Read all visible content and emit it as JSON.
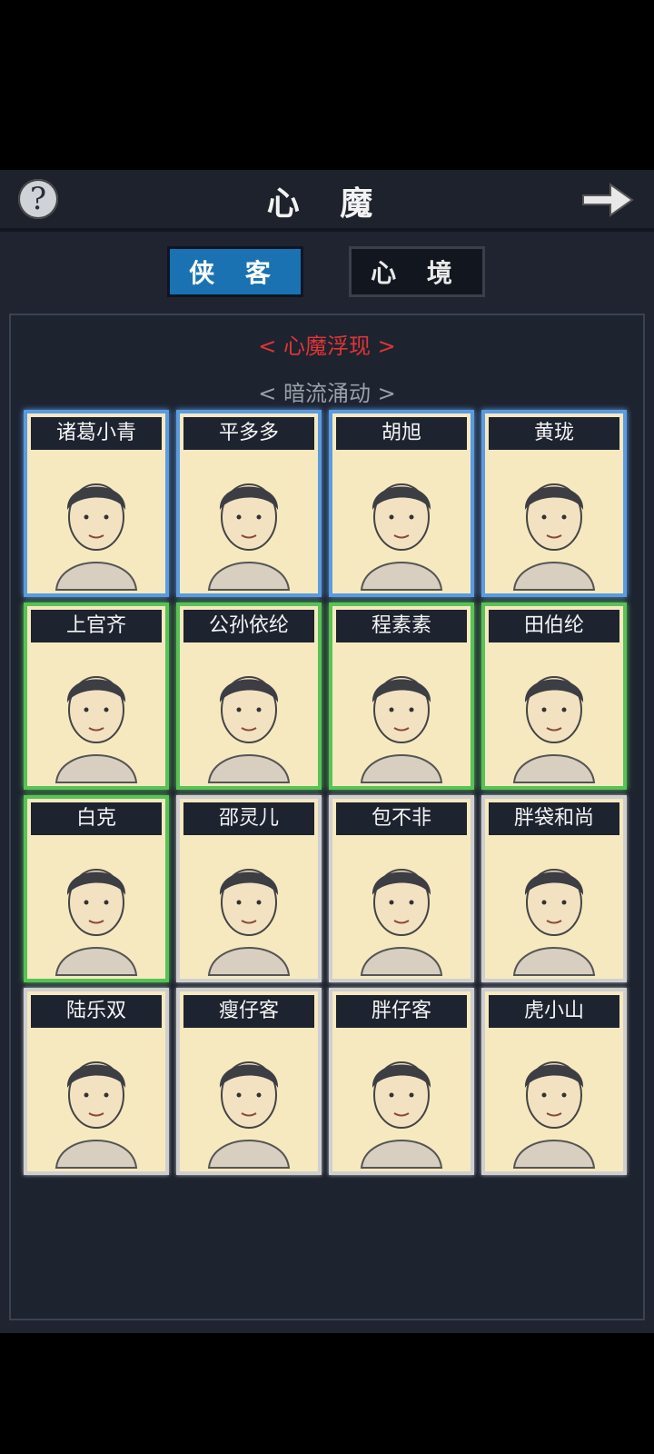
{
  "header": {
    "title": "心 魔",
    "help_symbol": "?",
    "next_icon": "arrow-right-icon"
  },
  "tabs": [
    {
      "label": "侠 客",
      "active": true
    },
    {
      "label": "心 境",
      "active": false
    }
  ],
  "sections": {
    "main": "< 心魔浮现 >",
    "sub": "< 暗流涌动 >"
  },
  "colors": {
    "blue": "#5b9be0",
    "green": "#58c257",
    "white": "#cfcfcf",
    "accent_red": "#e03535",
    "tab_active": "#1a72b3"
  },
  "characters": [
    {
      "name": "诸葛小青",
      "tier": "blue"
    },
    {
      "name": "平多多",
      "tier": "blue"
    },
    {
      "name": "胡旭",
      "tier": "blue"
    },
    {
      "name": "黄珑",
      "tier": "blue"
    },
    {
      "name": "上官齐",
      "tier": "green"
    },
    {
      "name": "公孙依纶",
      "tier": "green"
    },
    {
      "name": "程素素",
      "tier": "green"
    },
    {
      "name": "田伯纶",
      "tier": "green"
    },
    {
      "name": "白克",
      "tier": "green"
    },
    {
      "name": "邵灵儿",
      "tier": "white"
    },
    {
      "name": "包不非",
      "tier": "white"
    },
    {
      "name": "胖袋和尚",
      "tier": "white"
    },
    {
      "name": "陆乐双",
      "tier": "white"
    },
    {
      "name": "瘦仔客",
      "tier": "white"
    },
    {
      "name": "胖仔客",
      "tier": "white"
    },
    {
      "name": "虎小山",
      "tier": "white"
    }
  ]
}
